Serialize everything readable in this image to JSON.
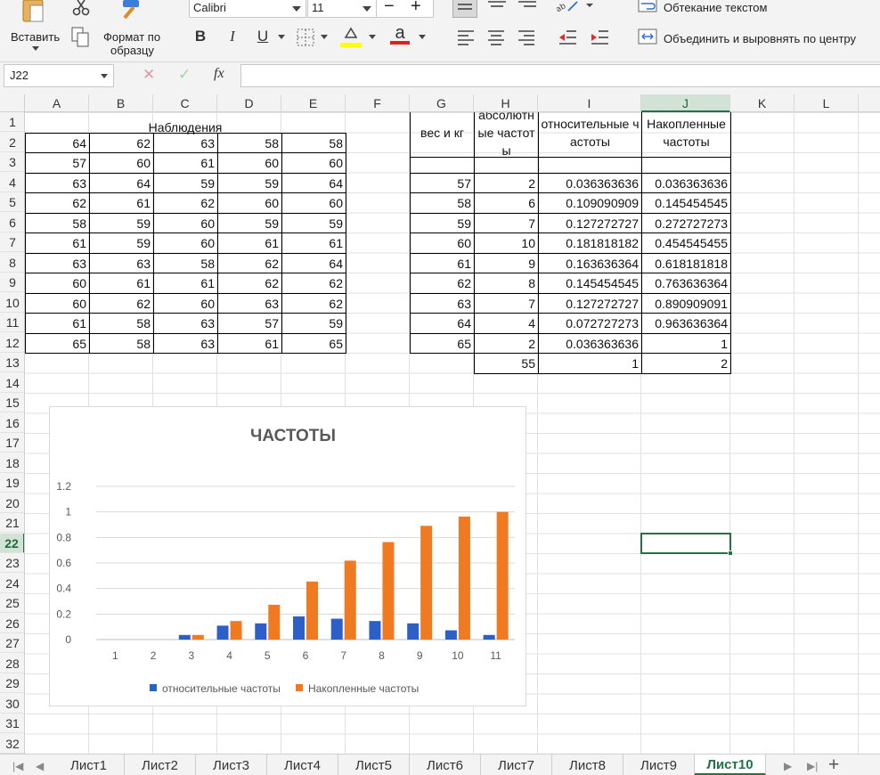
{
  "ribbon": {
    "paste_label": "Вставить",
    "format_painter_label_1": "Формат по",
    "format_painter_label_2": "образцу",
    "font_name": "Calibri",
    "font_size": "11",
    "bold": "B",
    "italic": "I",
    "underline": "U",
    "font_color_glyph": "a",
    "wrap_text_label": "Обтекание текстом",
    "merge_center_label": "Объединить и выровнять по центру",
    "colors": {
      "highlight": "#ffff00",
      "font_color": "#e02020",
      "accent": "#217346"
    }
  },
  "formula_bar": {
    "name_box": "J22",
    "fx_label": "fx",
    "formula": ""
  },
  "columns": [
    "A",
    "B",
    "C",
    "D",
    "E",
    "F",
    "G",
    "H",
    "I",
    "J",
    "K",
    "L"
  ],
  "rows": [
    "1",
    "2",
    "3",
    "4",
    "5",
    "6",
    "7",
    "8",
    "9",
    "10",
    "11",
    "12",
    "13",
    "14",
    "15",
    "16",
    "17",
    "18",
    "19",
    "20",
    "21",
    "22",
    "23",
    "24",
    "25",
    "26",
    "27",
    "28",
    "29",
    "30",
    "31",
    "32"
  ],
  "active_column": "J",
  "active_row": "22",
  "observations": {
    "title": "Наблюдения",
    "rows": [
      [
        "64",
        "62",
        "63",
        "58",
        "58"
      ],
      [
        "57",
        "60",
        "61",
        "60",
        "60"
      ],
      [
        "63",
        "64",
        "59",
        "59",
        "64"
      ],
      [
        "62",
        "61",
        "62",
        "60",
        "60"
      ],
      [
        "58",
        "59",
        "60",
        "59",
        "59"
      ],
      [
        "61",
        "59",
        "60",
        "61",
        "61"
      ],
      [
        "63",
        "63",
        "58",
        "62",
        "64"
      ],
      [
        "60",
        "61",
        "61",
        "62",
        "62"
      ],
      [
        "60",
        "62",
        "60",
        "63",
        "62"
      ],
      [
        "61",
        "58",
        "63",
        "57",
        "59"
      ],
      [
        "65",
        "58",
        "63",
        "61",
        "65"
      ]
    ]
  },
  "freq_table": {
    "headers": {
      "weight": "вес и кг",
      "absolute": "абсолютные частоты",
      "relative": "относительные частоты",
      "cumulative": "Накопленные частоты"
    },
    "rows": [
      [
        "57",
        "2",
        "0.036363636",
        "0.036363636"
      ],
      [
        "58",
        "6",
        "0.109090909",
        "0.145454545"
      ],
      [
        "59",
        "7",
        "0.127272727",
        "0.272727273"
      ],
      [
        "60",
        "10",
        "0.181818182",
        "0.454545455"
      ],
      [
        "61",
        "9",
        "0.163636364",
        "0.618181818"
      ],
      [
        "62",
        "8",
        "0.145454545",
        "0.763636364"
      ],
      [
        "63",
        "7",
        "0.127272727",
        "0.890909091"
      ],
      [
        "64",
        "4",
        "0.072727273",
        "0.963636364"
      ],
      [
        "65",
        "2",
        "0.036363636",
        "1"
      ]
    ],
    "totals": [
      "55",
      "1",
      "2"
    ]
  },
  "chart_data": {
    "type": "bar",
    "title": "ЧАСТОТЫ",
    "categories": [
      "1",
      "2",
      "3",
      "4",
      "5",
      "6",
      "7",
      "8",
      "9",
      "10",
      "11"
    ],
    "series": [
      {
        "name": "относительные частоты",
        "color": "#2e5fc6",
        "values": [
          null,
          null,
          0.036363636,
          0.109090909,
          0.127272727,
          0.181818182,
          0.163636364,
          0.145454545,
          0.127272727,
          0.072727273,
          0.036363636
        ]
      },
      {
        "name": "Накопленные частоты",
        "color": "#f07a22",
        "values": [
          null,
          null,
          0.036363636,
          0.145454545,
          0.272727273,
          0.454545455,
          0.618181818,
          0.763636364,
          0.890909091,
          0.963636364,
          1
        ]
      }
    ],
    "yticks": [
      "0",
      "0.2",
      "0.4",
      "0.6",
      "0.8",
      "1",
      "1.2"
    ],
    "ylim": [
      0,
      1.2
    ],
    "grid": true,
    "legend": "bottom"
  },
  "sheet_tabs": [
    "Лист1",
    "Лист2",
    "Лист3",
    "Лист4",
    "Лист5",
    "Лист6",
    "Лист7",
    "Лист8",
    "Лист9",
    "Лист10"
  ],
  "active_sheet": "Лист10",
  "add_sheet_glyph": "+"
}
